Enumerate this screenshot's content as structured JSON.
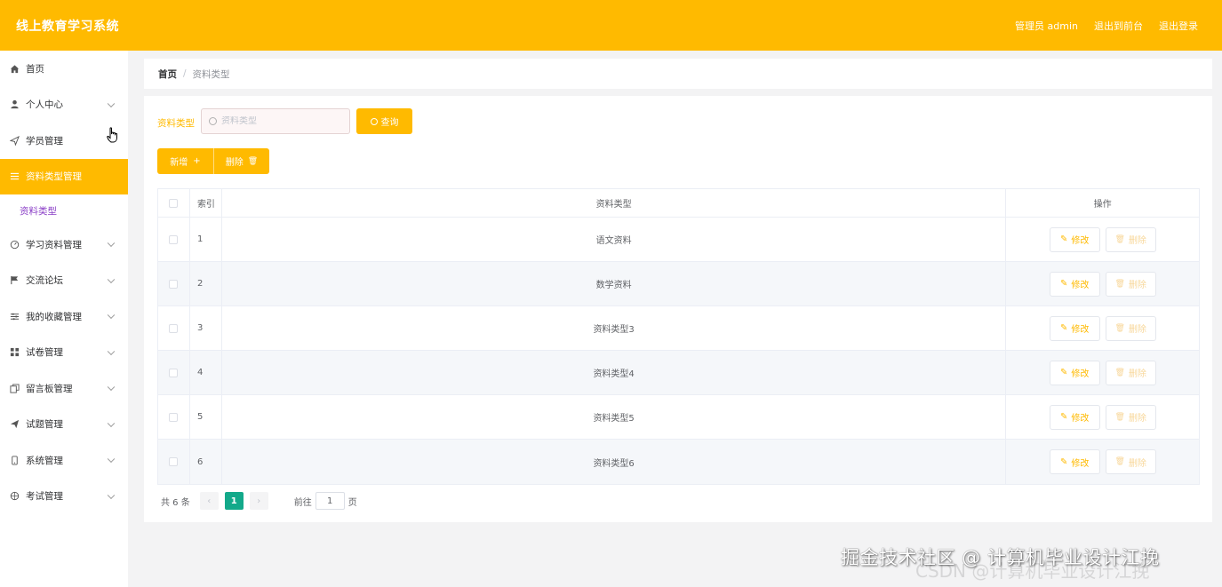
{
  "header": {
    "title": "线上教育学习系统",
    "admin_label": "管理员 admin",
    "front_label": "退出到前台",
    "logout_label": "退出登录"
  },
  "sidebar": {
    "items": [
      {
        "label": "首页",
        "icon": "home-icon"
      },
      {
        "label": "个人中心",
        "icon": "user-icon"
      },
      {
        "label": "学员管理",
        "icon": "send-icon"
      },
      {
        "label": "资料类型管理",
        "icon": "menu-icon",
        "active": true
      },
      {
        "label": "学习资料管理",
        "icon": "clock-icon"
      },
      {
        "label": "交流论坛",
        "icon": "flag-icon"
      },
      {
        "label": "我的收藏管理",
        "icon": "sliders-icon"
      },
      {
        "label": "试卷管理",
        "icon": "grid-icon"
      },
      {
        "label": "留言板管理",
        "icon": "copy-icon"
      },
      {
        "label": "试题管理",
        "icon": "paper-plane-icon"
      },
      {
        "label": "系统管理",
        "icon": "phone-icon"
      },
      {
        "label": "考试管理",
        "icon": "compass-icon"
      }
    ],
    "submenu_label": "资料类型"
  },
  "breadcrumb": {
    "home": "首页",
    "sep": "/",
    "current": "资料类型"
  },
  "search": {
    "label": "资料类型",
    "placeholder": "资料类型",
    "button": "查询"
  },
  "actions": {
    "add_label": "新增",
    "add_glyph": "+",
    "delete_label": "删除",
    "delete_glyph": "🗑"
  },
  "table": {
    "headers": {
      "index": "索引",
      "type": "资料类型",
      "op": "操作"
    },
    "edit_label": "修改",
    "edit_glyph": "✎",
    "delete_label": "删除",
    "delete_glyph": "🗑",
    "rows": [
      {
        "index": "1",
        "type": "语文资料"
      },
      {
        "index": "2",
        "type": "数学资料"
      },
      {
        "index": "3",
        "type": "资料类型3"
      },
      {
        "index": "4",
        "type": "资料类型4"
      },
      {
        "index": "5",
        "type": "资料类型5"
      },
      {
        "index": "6",
        "type": "资料类型6"
      }
    ]
  },
  "pagination": {
    "total": "共 6 条",
    "prev": "‹",
    "page": "1",
    "next": "›",
    "goto_label": "前往",
    "goto_value": "1",
    "goto_unit": "页"
  },
  "watermark": {
    "text": "掘金技术社区 @ 计算机毕业设计江挽",
    "faint": "CSDN @计算机毕业设计江挽"
  },
  "colors": {
    "accent": "#ffba00",
    "submenu": "#8b3fc7",
    "page_active": "#13a98a"
  }
}
